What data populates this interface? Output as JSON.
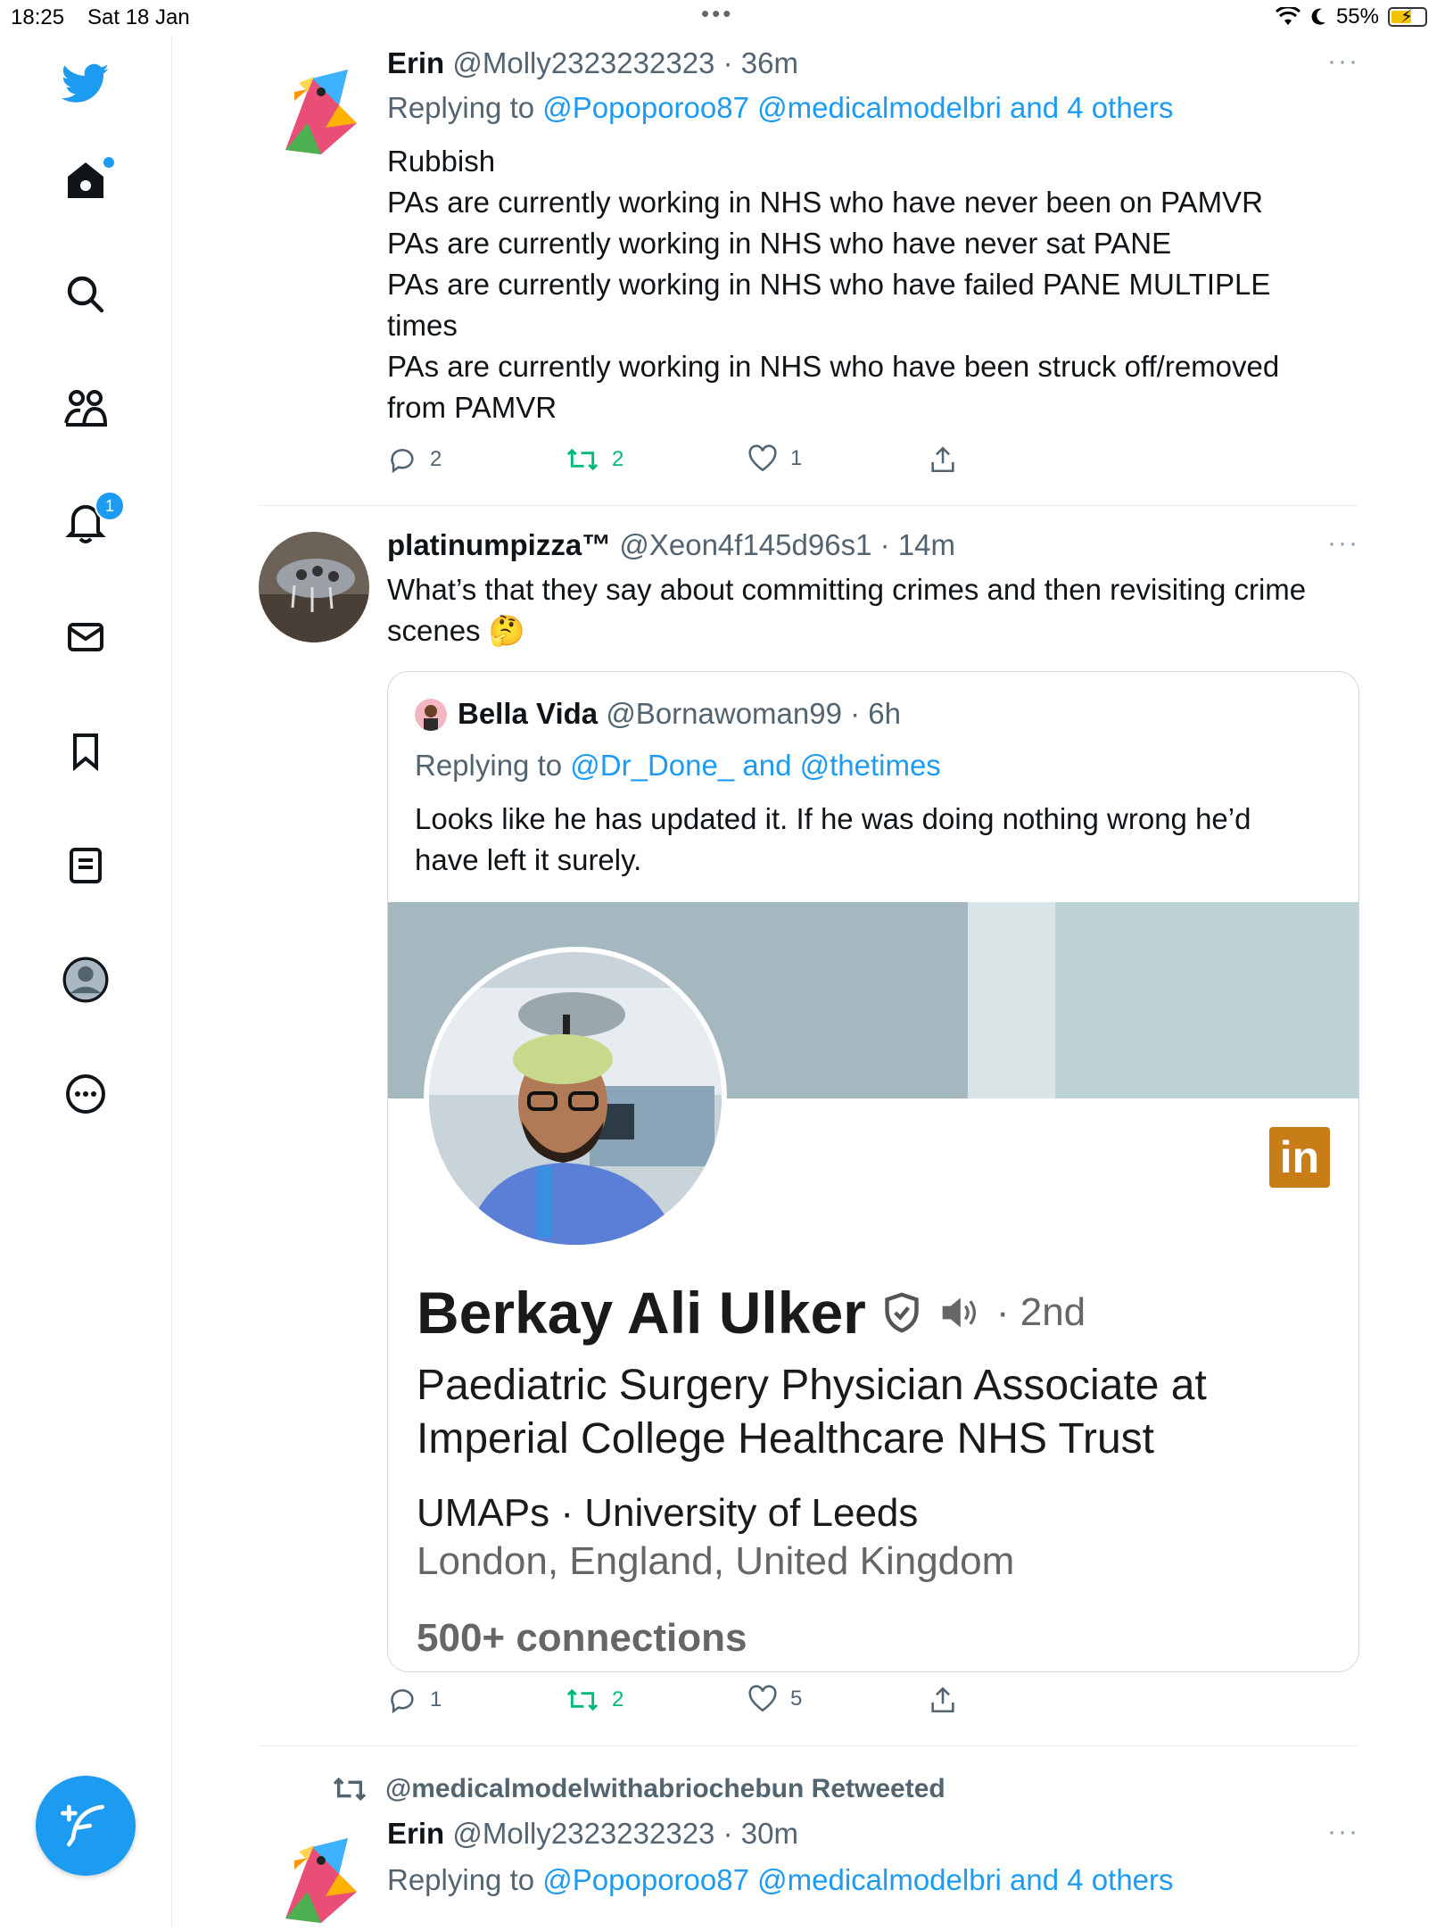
{
  "status_bar": {
    "time": "18:25",
    "date": "Sat 18 Jan",
    "battery": "55%",
    "handle_dots": "•••"
  },
  "sidebar": {
    "notification_count": "1"
  },
  "tweets": [
    {
      "name": "Erin",
      "handle": "@Molly2323232323",
      "time": "· 36m",
      "more": "···",
      "replying_prefix": "Replying to",
      "replying_links": "@Popoporoo87 @medicalmodelbri and 4 others",
      "body_lines": [
        "Rubbish",
        "PAs are currently working in NHS who have never been on PAMVR",
        "PAs are currently working in NHS who have never sat PANE",
        "PAs are currently working in NHS who have failed PANE MULTIPLE",
        "times",
        "PAs are currently working in NHS who have been struck off/removed",
        "from PAMVR"
      ],
      "replies": "2",
      "retweets": "2",
      "likes": "1"
    },
    {
      "name": "platinumpizza™",
      "handle": "@Xeon4f145d96s1",
      "time": "· 14m",
      "more": "···",
      "body_lines": [
        "What’s that they say about committing crimes and then revisiting crime",
        "scenes 🤔"
      ],
      "quote": {
        "name": "Bella Vida",
        "handle": "@Bornawoman99",
        "time": "· 6h",
        "replying_prefix": "Replying to",
        "replying_links": "@Dr_Done_ and @thetimes",
        "body_lines": [
          "Looks like he has updated it. If he was doing nothing wrong he’d",
          "have left it surely."
        ],
        "linkedin": {
          "logo": "in",
          "name": "Berkay Ali Ulker",
          "degree": "· 2nd",
          "title_lines": [
            "Paediatric Surgery Physician Associate at",
            "Imperial College Healthcare NHS Trust"
          ],
          "education": "UMAPs · University of Leeds",
          "location": "London, England, United Kingdom",
          "connections": "500+ connections"
        }
      },
      "replies": "1",
      "retweets": "2",
      "likes": "5"
    },
    {
      "retweeted_by": "@medicalmodelwithabriochebun Retweeted",
      "name": "Erin",
      "handle": "@Molly2323232323",
      "time": "· 30m",
      "more": "···",
      "replying_prefix": "Replying to",
      "replying_links": "@Popoporoo87 @medicalmodelbri and 4 others"
    }
  ],
  "colors": {
    "accent": "#1d9bf0",
    "retweet": "#00ba7c",
    "muted": "#536471"
  }
}
